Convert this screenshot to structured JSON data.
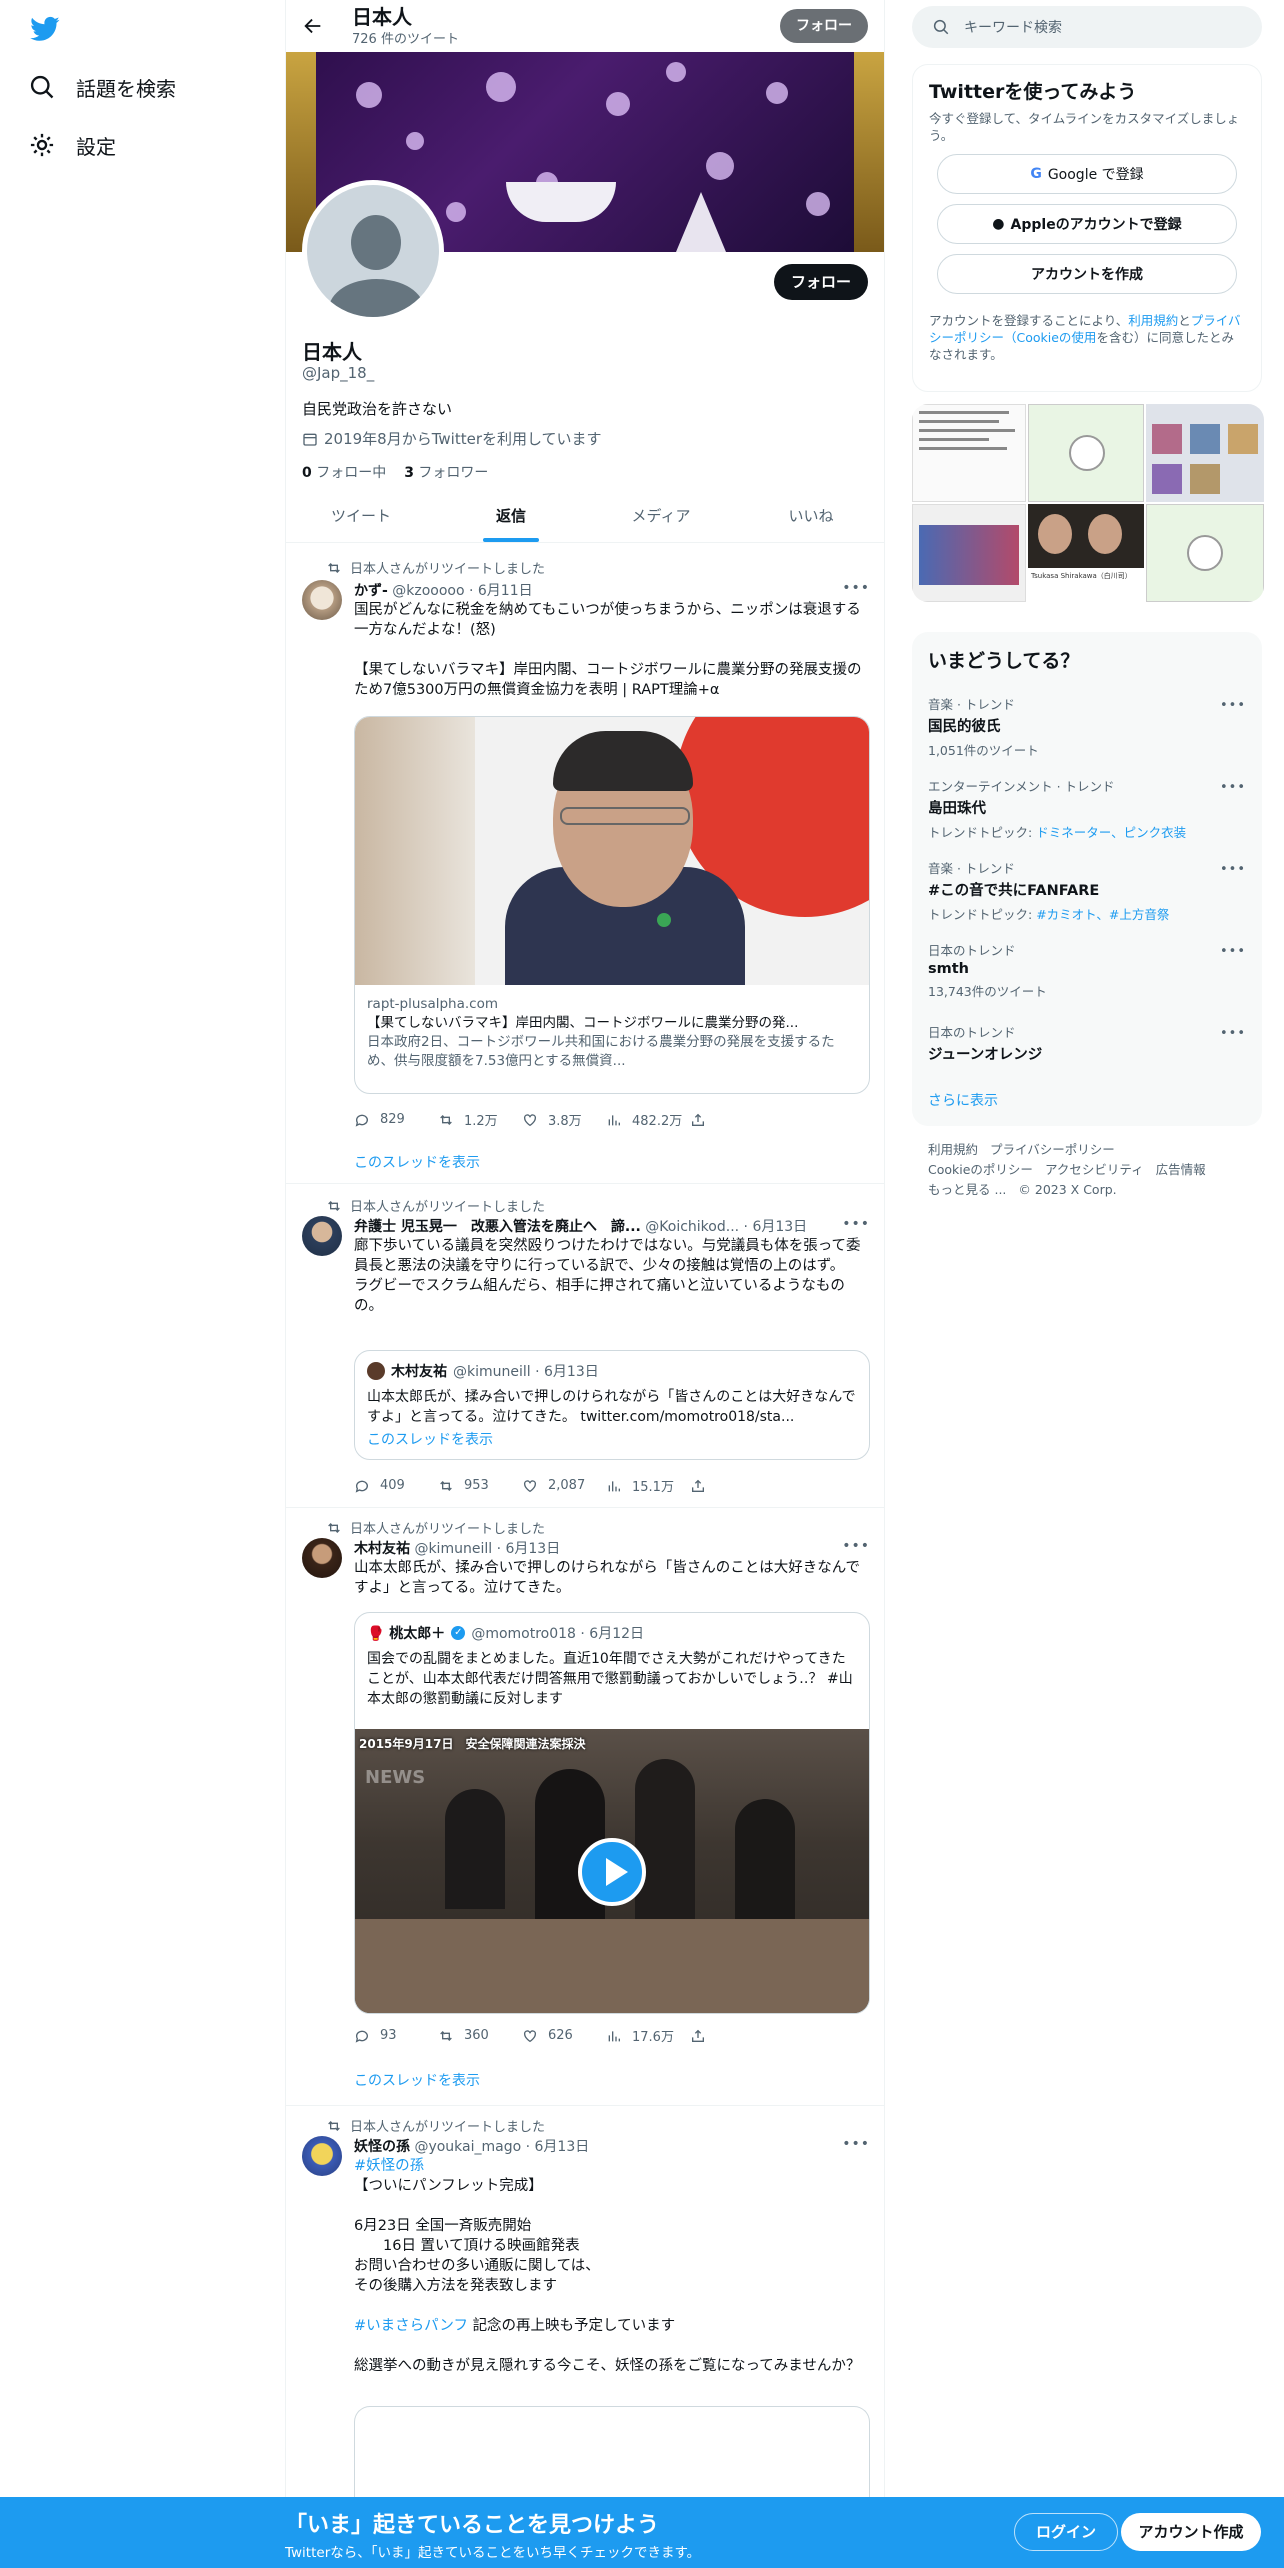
{
  "nav": {
    "explore": "話題を検索",
    "settings": "設定"
  },
  "header": {
    "name": "日本人",
    "tweet_count": "726 件のツイート",
    "follow": "フォロー"
  },
  "profile": {
    "name": "日本人",
    "handle": "@Jap_18_",
    "bio": "自民党政治を許さない",
    "joined": "2019年8月からTwitterを利用しています",
    "following_num": "0",
    "following_label": "フォロー中",
    "followers_num": "3",
    "followers_label": "フォロワー",
    "follow": "フォロー"
  },
  "tabs": [
    "ツイート",
    "返信",
    "メディア",
    "いいね"
  ],
  "tweets": [
    {
      "retweet": "日本人さんがリツイートしました",
      "name": "かず-",
      "handle": "@kzooooo · 6月11日",
      "text": "国民がどんなに税金を納めてもこいつが使っちまうから、ニッポンは衰退する一方なんだよな！(怒)\n\n【果てしないバラマキ】岸田内閣、コートジボワールに農業分野の発展支援のため7億5300万円の無償資金協力を表明 | RAPT理論+α",
      "card_domain": "rapt-plusalpha.com",
      "card_title": "【果てしないバラマキ】岸田内閣、コートジボワールに農業分野の発...",
      "card_desc": "日本政府2日、コートジボワール共和国における農業分野の発展を支援するため、供与限度額を7.53億円とする無償資...",
      "replies": "829",
      "retweets": "1.2万",
      "likes": "3.8万",
      "views": "482.2万",
      "thread": "このスレッドを表示"
    },
    {
      "retweet": "日本人さんがリツイートしました",
      "name": "弁護士 児玉晃一　改悪入管法を廃止へ　諦...",
      "handle": "@Koichikod... · 6月13日",
      "text": "廊下歩いている議員を突然殴りつけたわけではない。与党議員も体を張って委員長と悪法の決議を守りに行っている訳で、少々の接触は覚悟の上のはず。\nラグビーでスクラム組んだら、相手に押されて痛いと泣いているようなものの。",
      "quote_name": "木村友祐",
      "quote_handle": "@kimuneill · 6月13日",
      "quote_text": "山本太郎氏が、揉み合いで押しのけられながら「皆さんのことは大好きなんですよ」と言ってる。泣けてきた。 twitter.com/momotro018/sta...",
      "quote_thread": "このスレッドを表示",
      "replies": "409",
      "retweets": "953",
      "likes": "2,087",
      "views": "15.1万"
    },
    {
      "retweet": "日本人さんがリツイートしました",
      "name": "木村友祐",
      "handle": "@kimuneill · 6月13日",
      "text": "山本太郎氏が、揉み合いで押しのけられながら「皆さんのことは大好きなんですよ」と言ってる。泣けてきた。",
      "quote_name": "🥊 桃太郎＋",
      "quote_handle": "@momotro018 · 6月12日",
      "quote_text": "国会での乱闘をまとめました。直近10年間でさえ大勢がこれだけやってきたことが、山本太郎代表だけ問答無用で懲罰動議っておかしいでしょう‥？ #山本太郎の懲罰動議に反対します",
      "video_caption": "2015年9月17日　安全保障関連法案採決",
      "video_logo": "NEWS",
      "replies": "93",
      "retweets": "360",
      "likes": "626",
      "views": "17.6万",
      "thread": "このスレッドを表示"
    },
    {
      "retweet": "日本人さんがリツイートしました",
      "name": "妖怪の孫",
      "handle": "@youkai_mago · 6月13日",
      "hashtag": "#妖怪の孫",
      "text": "【ついにパンフレット完成】\n\n6月23日 全国一斉販売開始\n　　16日 置いて頂ける映画館発表\nお問い合わせの多い通販に関しては、\nその後購入方法を発表致します",
      "hashtag2": "#いまさらパンフ",
      "text2": "記念の再上映も予定しています",
      "text3": "総選挙への動きが見え隠れする今こそ、妖怪の孫をご覧になってみませんか？"
    }
  ],
  "right": {
    "search_placeholder": "キーワード検索",
    "signup_title": "Twitterを使ってみよう",
    "signup_sub": "今すぐ登録して、タイムラインをカスタマイズしましょう。",
    "google": "Google で登録",
    "apple": "Appleのアカウントで登録",
    "create": "アカウントを作成",
    "terms_a": "アカウントを登録することにより、",
    "terms_l1": "利用規約",
    "terms_b": "と",
    "terms_l2": "プライバシーポリシー（Cookieの使用",
    "terms_c": "を含む）に同意したとみなされます。",
    "gallery_label": "Tsukasa Shirakawa（白川司）",
    "trends_title": "いまどうしてる？",
    "trends": [
      {
        "cat": "音楽 · トレンド",
        "title": "国民的彼氏",
        "count": "1,051件のツイート"
      },
      {
        "cat": "エンターテインメント · トレンド",
        "title": "島田珠代",
        "topics_label": "トレンドトピック:",
        "topics": "ドミネーター、ピンク衣装"
      },
      {
        "cat": "音楽 · トレンド",
        "title": "#この音で共にFANFARE",
        "topics_label": "トレンドトピック:",
        "topics": "#カミオト、#上方音祭"
      },
      {
        "cat": "日本のトレンド",
        "title": "smth",
        "count": "13,743件のツイート"
      },
      {
        "cat": "日本のトレンド",
        "title": "ジューンオレンジ"
      }
    ],
    "show_more": "さらに表示",
    "footer": [
      "利用規約",
      "プライバシーポリシー",
      "Cookieのポリシー",
      "アクセシビリティ",
      "広告情報",
      "もっと見る ...",
      "© 2023 X Corp."
    ]
  },
  "bottom": {
    "headline": "「いま」起きていることを見つけよう",
    "sub": "Twitterなら、「いま」起きていることをいち早くチェックできます。",
    "login": "ログイン",
    "signup": "アカウント作成"
  }
}
